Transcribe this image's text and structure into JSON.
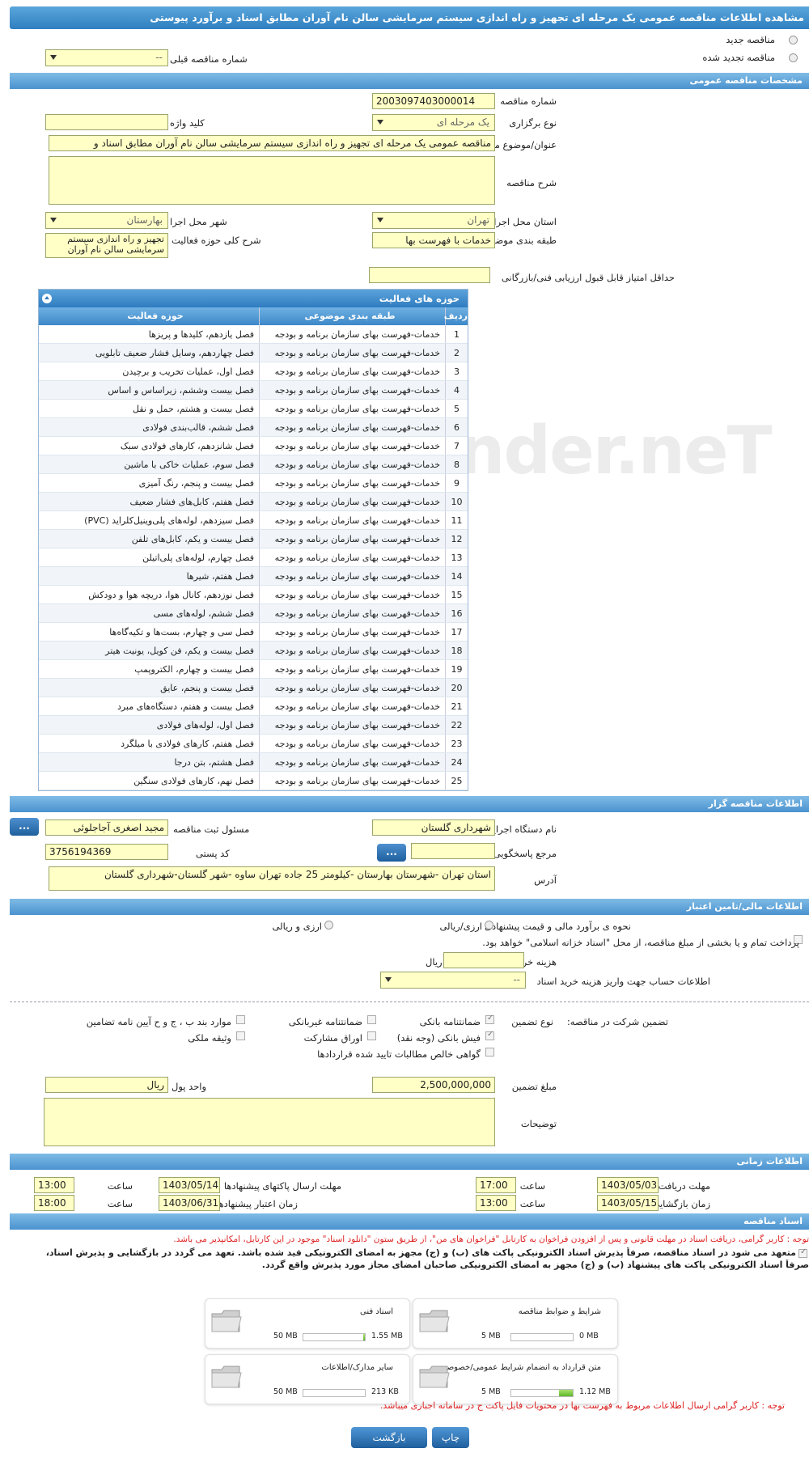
{
  "page_title": "مشاهده اطلاعات مناقصه عمومی یک مرحله ای تجهیز و راه اندازی سیستم سرمایشی سالن نام آوران مطابق اسناد و برآورد پیوستی",
  "tender_type": {
    "new_label": "مناقصه جدید",
    "renewed_label": "مناقصه تجدید شده",
    "prev_number_label": "شماره مناقصه قبلی",
    "prev_number_value": "--"
  },
  "general": {
    "section_title": "مشخصات مناقصه عمومی",
    "number_label": "شماره مناقصه",
    "number_value": "2003097403000014",
    "holding_type_label": "نوع برگزاری",
    "holding_type_value": "یک مرحله ای",
    "keyword_label": "کلید واژه",
    "keyword_value": "",
    "subject_label": "عنوان/موضوع مناقصه",
    "subject_value": "مناقصه عمومی یک مرحله ای تجهیز و راه اندازی سیستم سرمایشی سالن نام آوران مطابق اسناد و",
    "description_label": "شرح مناقصه",
    "description_value": "",
    "province_label": "استان محل اجرا",
    "province_value": "تهران",
    "city_label": "شهر محل اجرا",
    "city_value": "بهارستان",
    "category_label": "طبقه بندی موضوعی",
    "category_value": "خدمات با فهرست بها",
    "activity_desc_label": "شرح کلی حوزه فعالیت",
    "activity_desc_value": "تجهیز و راه اندازی سیستم سرمایشی سالن نام آوران",
    "min_score_label": "حداقل امتیاز قابل قبول ارزیابی فنی/بازرگانی",
    "min_score_value": ""
  },
  "activities": {
    "title": "حوزه های فعالیت",
    "col_idx": "ردیف",
    "col_cat": "طبقه بندی موضوعی",
    "col_act": "حوزه فعالیت",
    "rows": [
      {
        "i": "1",
        "cat": "خدمات-فهرست بهای سازمان برنامه و بودجه",
        "act": "فصل یازدهم، کلیدها و پریزها"
      },
      {
        "i": "2",
        "cat": "خدمات-فهرست بهای سازمان برنامه و بودجه",
        "act": "فصل چهاردهم، وسایل فشار ضعیف تابلویی"
      },
      {
        "i": "3",
        "cat": "خدمات-فهرست بهای سازمان برنامه و بودجه",
        "act": "فصل اول، عملیات تخریب و برچیدن"
      },
      {
        "i": "4",
        "cat": "خدمات-فهرست بهای سازمان برنامه و بودجه",
        "act": "فصل بیست وششم، زیراساس و اساس"
      },
      {
        "i": "5",
        "cat": "خدمات-فهرست بهای سازمان برنامه و بودجه",
        "act": "فصل بیست و هشتم، حمل و نقل"
      },
      {
        "i": "6",
        "cat": "خدمات-فهرست بهای سازمان برنامه و بودجه",
        "act": "فصل ششم، قالب‌بندی فولادی"
      },
      {
        "i": "7",
        "cat": "خدمات-فهرست بهای سازمان برنامه و بودجه",
        "act": "فصل شانزدهم، کارهای فولادی سبک"
      },
      {
        "i": "8",
        "cat": "خدمات-فهرست بهای سازمان برنامه و بودجه",
        "act": "فصل سوم، عملیات خاکی با ماشین"
      },
      {
        "i": "9",
        "cat": "خدمات-فهرست بهای سازمان برنامه و بودجه",
        "act": "فصل بیست و پنجم، رنگ آمیزی"
      },
      {
        "i": "10",
        "cat": "خدمات-فهرست بهای سازمان برنامه و بودجه",
        "act": "فصل هفتم، کابل‌های فشار ضعیف"
      },
      {
        "i": "11",
        "cat": "خدمات-فهرست بهای سازمان برنامه و بودجه",
        "act": "فصل سیزدهم، لوله‌های پلی‌وینیل‌کلراید (PVC)"
      },
      {
        "i": "12",
        "cat": "خدمات-فهرست بهای سازمان برنامه و بودجه",
        "act": "فصل بیست و یکم، کابل‌های تلفن"
      },
      {
        "i": "13",
        "cat": "خدمات-فهرست بهای سازمان برنامه و بودجه",
        "act": "فصل چهارم، لوله‌های پلی‌اتیلن"
      },
      {
        "i": "14",
        "cat": "خدمات-فهرست بهای سازمان برنامه و بودجه",
        "act": "فصل هفتم، شیرها"
      },
      {
        "i": "15",
        "cat": "خدمات-فهرست بهای سازمان برنامه و بودجه",
        "act": "فصل نوزدهم، کانال هوا، دریچه هوا و دودکش"
      },
      {
        "i": "16",
        "cat": "خدمات-فهرست بهای سازمان برنامه و بودجه",
        "act": "فصل ششم، لوله‌های مسی"
      },
      {
        "i": "17",
        "cat": "خدمات-فهرست بهای سازمان برنامه و بودجه",
        "act": "فصل سی و چهارم، بست‌ها و تکیه‌گاه‌ها"
      },
      {
        "i": "18",
        "cat": "خدمات-فهرست بهای سازمان برنامه و بودجه",
        "act": "فصل بیست و یکم، فن کویل، یونیت هیتر"
      },
      {
        "i": "19",
        "cat": "خدمات-فهرست بهای سازمان برنامه و بودجه",
        "act": "فصل بیست و چهارم، الکتروپمپ"
      },
      {
        "i": "20",
        "cat": "خدمات-فهرست بهای سازمان برنامه و بودجه",
        "act": "فصل بیست و پنجم، عایق"
      },
      {
        "i": "21",
        "cat": "خدمات-فهرست بهای سازمان برنامه و بودجه",
        "act": "فصل بیست و هفتم، دستگاه‌های مبرد"
      },
      {
        "i": "22",
        "cat": "خدمات-فهرست بهای سازمان برنامه و بودجه",
        "act": "فصل اول، لوله‌های فولادی"
      },
      {
        "i": "23",
        "cat": "خدمات-فهرست بهای سازمان برنامه و بودجه",
        "act": "فصل هفتم، کارهای فولادی با میلگرد"
      },
      {
        "i": "24",
        "cat": "خدمات-فهرست بهای سازمان برنامه و بودجه",
        "act": "فصل هشتم، بتن درجا"
      },
      {
        "i": "25",
        "cat": "خدمات-فهرست بهای سازمان برنامه و بودجه",
        "act": "فصل نهم، کارهای فولادی سنگین"
      }
    ]
  },
  "organizer": {
    "section_title": "اطلاعات مناقصه گزار",
    "org_label": "نام دستگاه اجرایی مناقصه گزار",
    "org_value": "شهرداری گلستان",
    "officer_label": "مسئول ثبت مناقصه",
    "officer_value": "مجید اصغری آجاجلوئی",
    "ref_label": "مرجع پاسخگویی",
    "ref_value": "",
    "postal_label": "کد پستی",
    "postal_value": "3756194369",
    "address_label": "آدرس",
    "address_value": "استان تهران -شهرستان بهارستان -کیلومتر 25 جاده تهران ساوه -شهر گلستان-شهرداری گلستان",
    "dots": "..."
  },
  "finance": {
    "section_title": "اطلاعات مالی/تامین اعتبار",
    "method_label": "نحوه ی برآورد مالی و قیمت پیشنهادی",
    "opt1": "ارزی/ریالی",
    "opt2": "ارزی و ریالی",
    "treasury_text": "پرداخت تمام و یا بخشی از مبلغ مناقصه، از محل \"اسناد خزانه اسلامی\" خواهد بود.",
    "doc_cost_label": "هزینه خرید اسناد",
    "doc_cost_unit": "ریال",
    "doc_cost_value": "",
    "account_label": "اطلاعات حساب جهت واریز هزینه خرید اسناد",
    "account_value": "--"
  },
  "guarantee": {
    "participation_label": "تضمین شرکت در مناقصه:",
    "type_label": "نوع تضمین",
    "items": {
      "bank": "ضمانتنامه بانکی",
      "nonbank": "ضمانتنامه غیربانکی",
      "clauses": "موارد بند ب ، ج و ح آیین نامه تضامین",
      "check": "فیش بانکی (وجه نقد)",
      "bonds": "اوراق مشارکت",
      "property": "وثیقه ملکی",
      "claims": "گواهی خالص مطالبات تایید شده قراردادها"
    },
    "amount_label": "مبلغ تضمین",
    "amount_value": "2,500,000,000",
    "currency_label": "واحد پول",
    "currency_value": "ریال",
    "notes_label": "توضیحات",
    "notes_value": ""
  },
  "timing": {
    "section_title": "اطلاعات زمانی",
    "receive_label": "مهلت دریافت اسناد",
    "receive_date": "1403/05/03",
    "receive_time": "17:00",
    "submit_label": "مهلت ارسال پاکتهای پیشنهادها",
    "submit_date": "1403/05/14",
    "submit_time": "13:00",
    "open_label": "زمان بازگشایی پاکت ها",
    "open_date": "1403/05/15",
    "open_time": "13:00",
    "validity_label": "زمان اعتبار پیشنهادها",
    "validity_date": "1403/06/31",
    "validity_time": "18:00",
    "time_label": "ساعت"
  },
  "documents": {
    "section_title": "اسناد مناقصه",
    "notice_red": "توجه : کاربر گرامی، دریافت اسناد در مهلت قانونی و پس از افزودن فراخوان به کارتابل \"فراخوان های من\"، از طریق ستون \"دانلود اسناد\" موجود در این کارتابل، امکانپذیر می باشد.",
    "notice_bold1": "متعهد می شود در اسناد مناقصه، صرفاً پذیرش اسناد الکترونیکی پاکت های (ب) و (ج) مجهز به امضای الکترونیکی قید شده باشد. تعهد می گردد در بازگشایی و پذیرش اسناد،",
    "notice_bold2": "صرفاً اسناد الکترونیکی پاکت های پیشنهاد (ب) و (ج) مجهز به امضای الکترونیکی صاحبان امضای مجاز مورد پذیرش واقع گردد.",
    "cards": [
      {
        "name": "شرایط و ضوابط مناقصه",
        "max": "5 MB",
        "used": "0 MB",
        "fill": 0
      },
      {
        "name": "اسناد فنی",
        "max": "50 MB",
        "used": "1.55 MB",
        "fill": 0.03
      },
      {
        "name": "متن قرارداد به انضمام شرایط عمومی/خصوصی",
        "max": "5 MB",
        "used": "1.12 MB",
        "fill": 0.22
      },
      {
        "name": "سایر مدارک/اطلاعات",
        "max": "50 MB",
        "used": "213 KB",
        "fill": 0.004
      }
    ],
    "footer_red": "توجه : کاربر گرامی ارسال اطلاعات مربوط به فهرست بها در محتویات فایل پاکت ج در سامانه اجباری میباشد."
  },
  "buttons": {
    "print": "چاپ",
    "back": "بازگشت"
  },
  "watermark": "AriaTender.neT"
}
